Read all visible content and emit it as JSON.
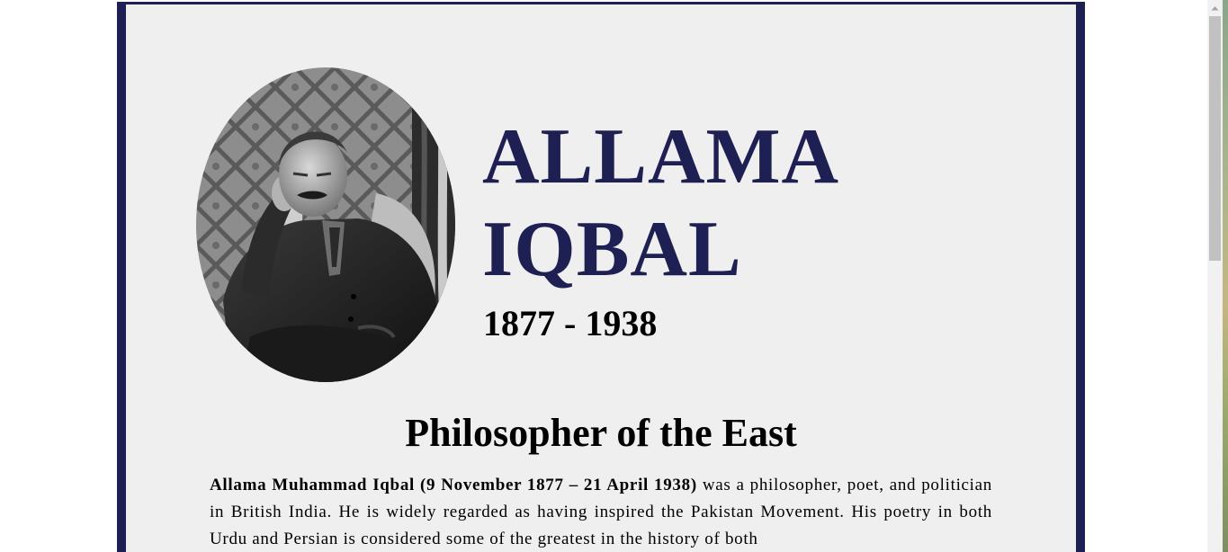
{
  "header": {
    "name_line1": "ALLAMA",
    "name_line2": "IQBAL",
    "years": "1877 - 1938"
  },
  "portrait": {
    "icon": "portrait-photo-icon"
  },
  "section": {
    "title": "Philosopher of the East"
  },
  "bio": {
    "lead": "Allama Muhammad Iqbal (9 November 1877 – 21 April 1938)",
    "text": " was a philosopher, poet, and politician in British India. He is widely regarded as having inspired the Pakistan Movement. His poetry in both Urdu and Persian is considered some of the greatest in the history of both"
  },
  "colors": {
    "accent": "#1e1f52",
    "page_bg": "#efefef",
    "frame": "#1e1f52"
  },
  "scrollbar": {
    "up_icon": "scroll-up-arrow-icon"
  }
}
